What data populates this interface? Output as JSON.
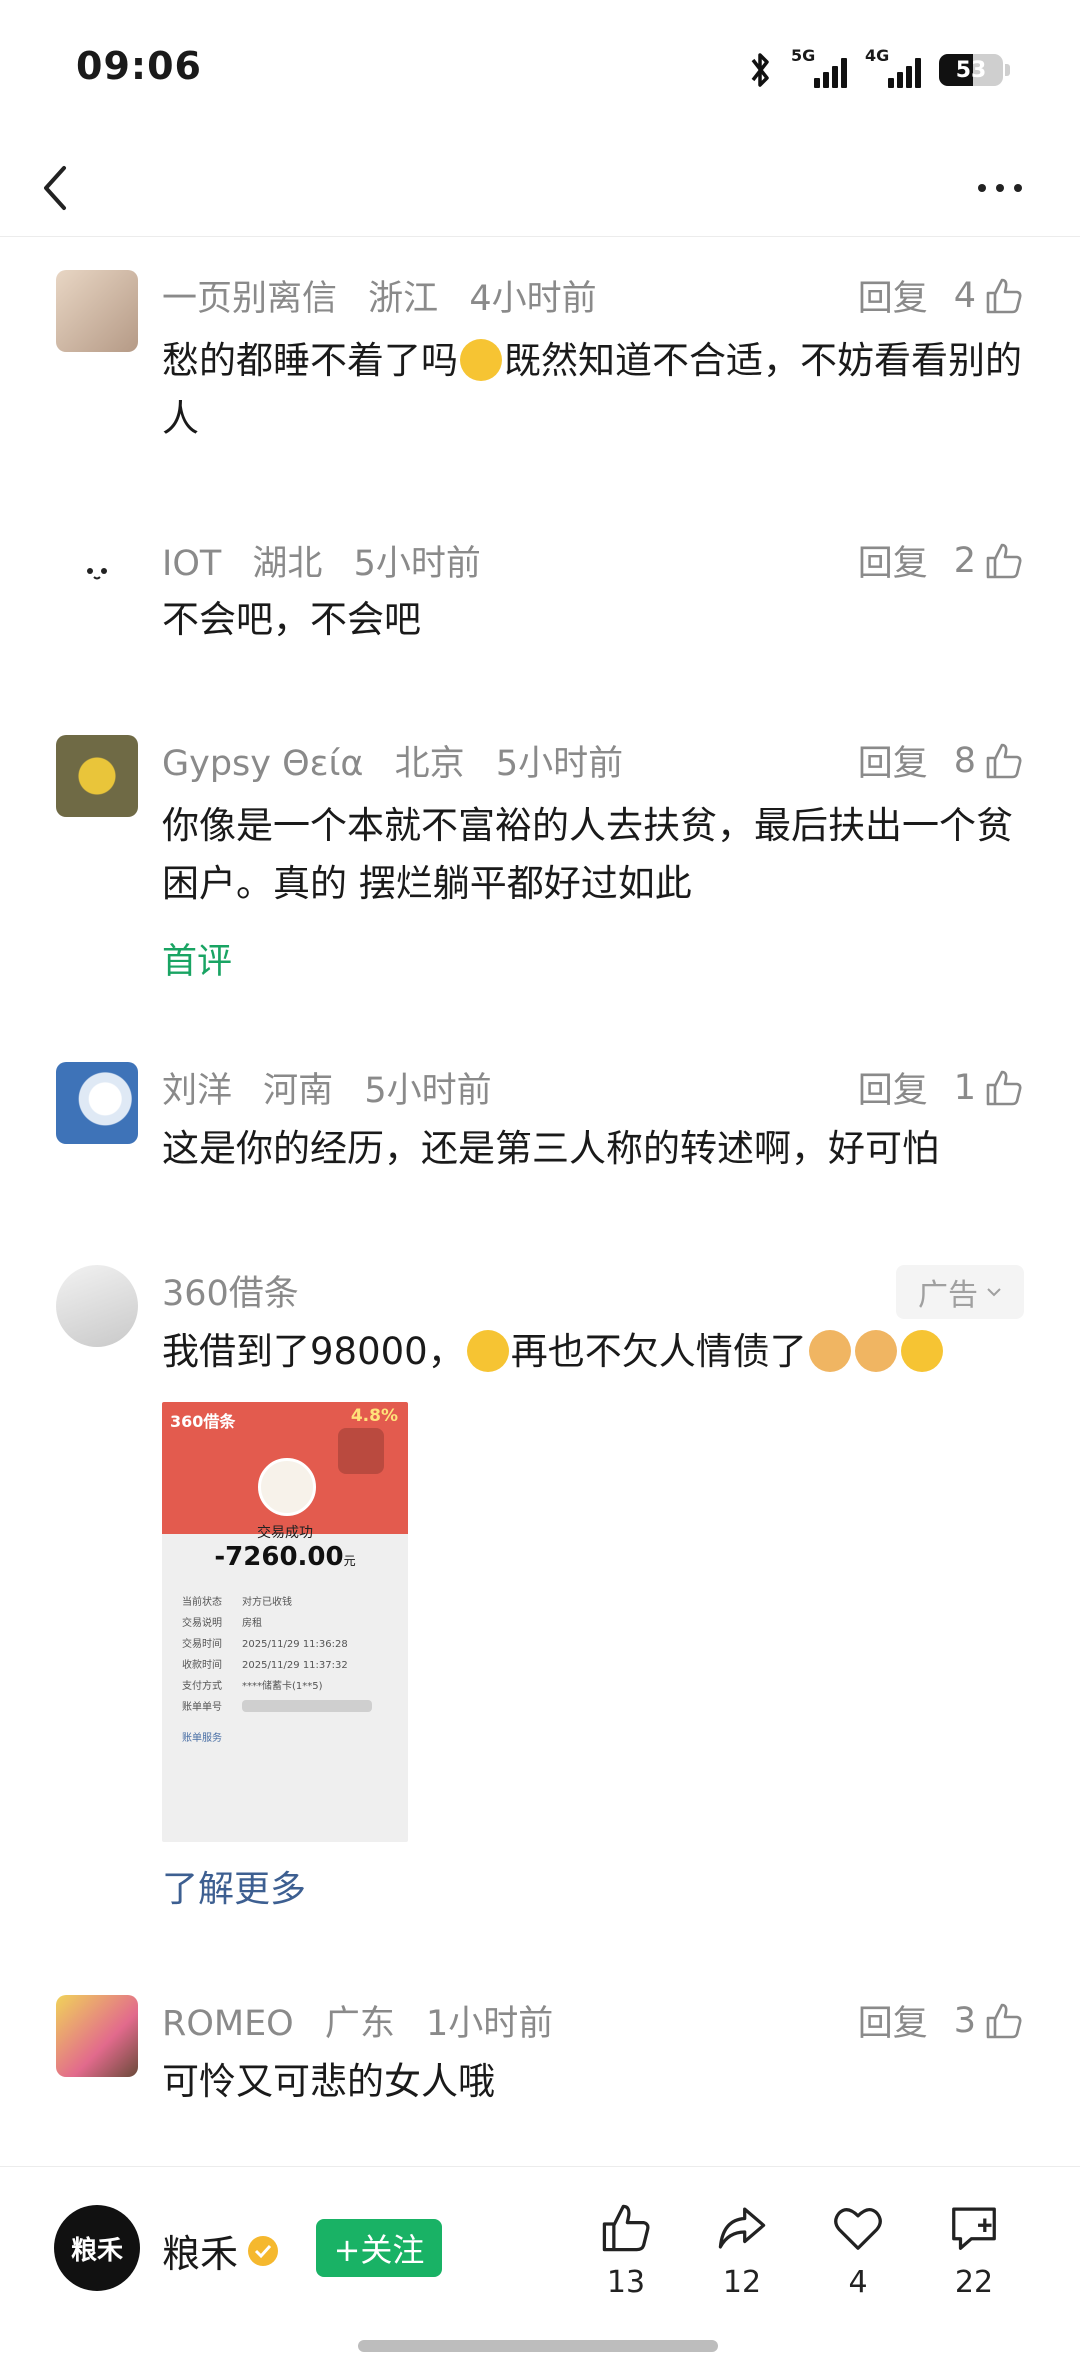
{
  "status_bar": {
    "time": "09:06",
    "net1": "5G",
    "net2": "4G",
    "battery": "53"
  },
  "nav": {
    "back_icon": "chevron-left-icon",
    "more_icon": "more-dots-icon"
  },
  "comments": [
    {
      "user": "一页别离信",
      "location": "浙江",
      "time": "4小时前",
      "reply": "回复",
      "likes": "4",
      "text_a": "愁的都睡不着了吗",
      "text_b": "既然知道不合适，不妨看看别的人",
      "avatar_color": "#d9c2ad"
    },
    {
      "user": "IOT",
      "location": "湖北",
      "time": "5小时前",
      "reply": "回复",
      "likes": "2",
      "text": "不会吧，不会吧",
      "avatar_color": "#ffffff"
    },
    {
      "user": "Gypsy Θεία",
      "location": "北京",
      "time": "5小时前",
      "reply": "回复",
      "likes": "8",
      "text": "你像是一个本就不富裕的人去扶贫，最后扶出一个贫困户。真的 摆烂躺平都好过如此",
      "tag": "首评",
      "avatar_color": "#8a8458"
    },
    {
      "user": "刘洋",
      "location": "河南",
      "time": "5小时前",
      "reply": "回复",
      "likes": "1",
      "text": "这是你的经历，还是第三人称的转述啊，好可怕",
      "avatar_color": "#4f7fbf"
    },
    {
      "user": "ROMEO",
      "location": "广东",
      "time": "1小时前",
      "reply": "回复",
      "likes": "3",
      "text": "可怜又可悲的女人哦",
      "avatar_color": "#c9b07a"
    }
  ],
  "ad": {
    "user": "360借条",
    "badge": "广告",
    "text_a": "我借到了98000，",
    "text_b": "再也不欠人情债了",
    "learn_more": "了解更多",
    "image": {
      "logo": "360借条",
      "pct": "4.8%",
      "status": "交易成功",
      "amount": "-7260.00",
      "amount_unit": "元",
      "rows": [
        {
          "k": "当前状态",
          "v": "对方已收钱"
        },
        {
          "k": "交易说明",
          "v": "房租"
        },
        {
          "k": "交易时间",
          "v": "2025/11/29  11:36:28"
        },
        {
          "k": "收款时间",
          "v": "2025/11/29  11:37:32"
        },
        {
          "k": "支付方式",
          "v": "****储蓄卡(1**5)"
        },
        {
          "k": "账单单号",
          "v": ""
        }
      ],
      "service": "账单服务"
    }
  },
  "bottom": {
    "author": "粮禾",
    "avatar_text": "粮禾",
    "follow": "+关注",
    "like_count": "13",
    "share_count": "12",
    "fav_count": "4",
    "comment_count": "22"
  }
}
